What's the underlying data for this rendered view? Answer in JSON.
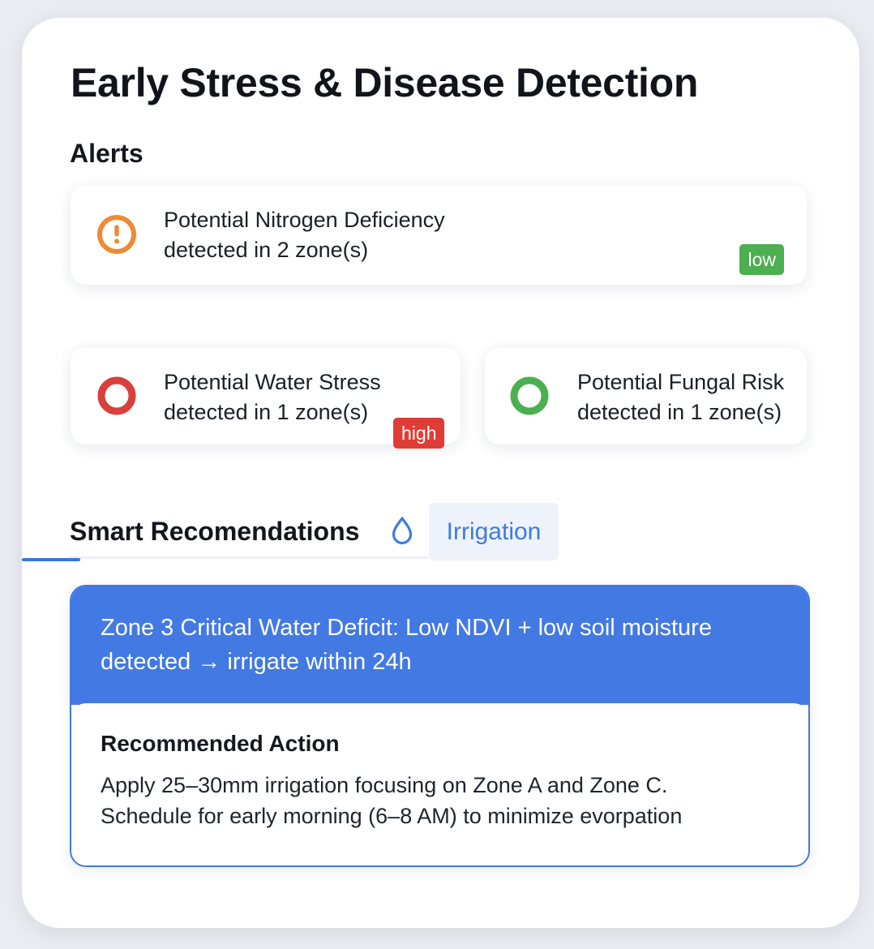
{
  "page": {
    "title": "Early Stress & Disease Detection"
  },
  "alerts": {
    "heading": "Alerts",
    "items": [
      {
        "line1": "Potential Nitrogen Deficiency",
        "line2": "detected in 2 zone(s)",
        "badge": "low",
        "icon": "exclamation-circle-icon",
        "icon_color": "#ee8a37",
        "badge_color": "#4caf50"
      },
      {
        "line1": "Potential Water Stress",
        "line2": "detected in 1 zone(s)",
        "badge": "high",
        "icon": "ring-icon",
        "icon_color": "#d8403c",
        "badge_color": "#e03c36"
      },
      {
        "line1": "Potential Fungal Risk",
        "line2": "detected in 1 zone(s)",
        "icon": "ring-icon",
        "icon_color": "#4caf50"
      }
    ]
  },
  "recommendations": {
    "tab_smart": "Smart Recomendations",
    "tab_irrigation": "Irrigation",
    "tab_icon": "water-drop-icon",
    "accent_color": "#4279e3",
    "header_line1": "Zone 3 Critical Water Deficit: Low NDVI + low soil moisture",
    "header_line2": "detected → irrigate within 24h",
    "action_label": "Recommended Action",
    "action_line1": "Apply 25–30mm irrigation focusing on Zone A and Zone C.",
    "action_line2": "Schedule for early morning (6–8 AM) to minimize evorpation"
  }
}
